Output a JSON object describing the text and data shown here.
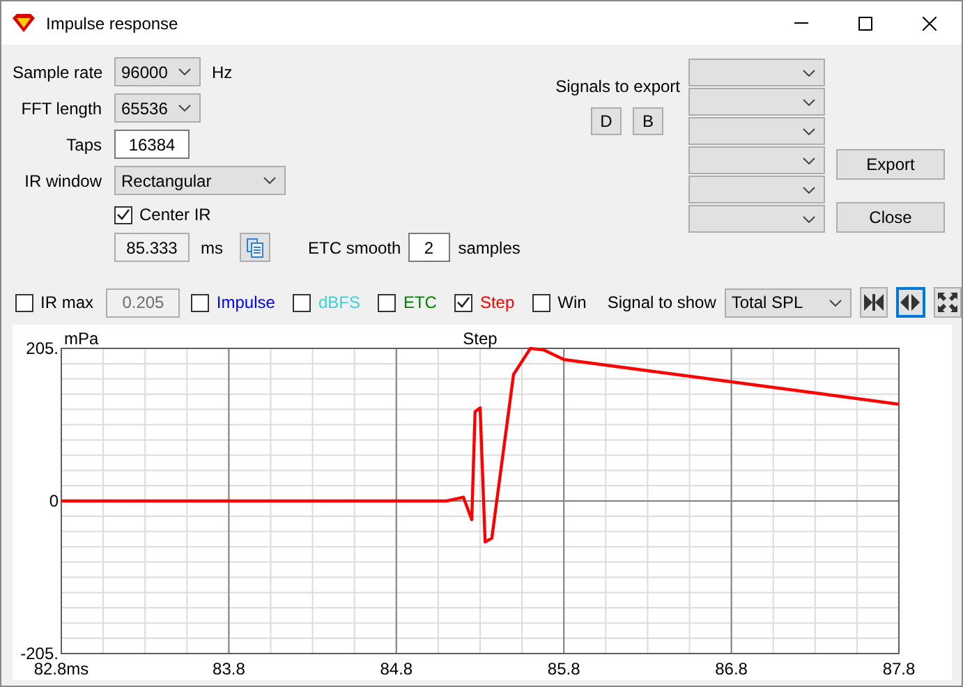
{
  "window": {
    "title": "Impulse response"
  },
  "form": {
    "fields": [
      {
        "kind": "select",
        "label": "Sample rate",
        "value": "96000",
        "unit": "Hz"
      },
      {
        "kind": "select",
        "label": "FFT length",
        "value": "65536"
      },
      {
        "kind": "input",
        "label": "Taps",
        "value": "16384"
      },
      {
        "kind": "select",
        "label": "IR window",
        "value": "Rectangular"
      }
    ],
    "center_ir": {
      "label": "Center IR",
      "checked": true
    },
    "delay": {
      "value": "85.333",
      "unit": "ms"
    },
    "etc_smooth": {
      "label": "ETC smooth",
      "value": "2",
      "unit": "samples"
    }
  },
  "export": {
    "label": "Signals to export",
    "buttons": [
      "D",
      "B"
    ],
    "slots": [
      {
        "kind": "dropdown"
      },
      {
        "kind": "dropdown"
      },
      {
        "kind": "dropdown"
      },
      {
        "kind": "dropdown"
      },
      {
        "kind": "dropdown"
      },
      {
        "kind": "dropdown"
      }
    ],
    "actions": [
      "Export",
      "Close"
    ]
  },
  "toolbar": {
    "ir_max": {
      "label": "IR max",
      "checked": false,
      "value": "0.205",
      "disabled": true
    },
    "traces": [
      {
        "label": "Impulse",
        "checked": false,
        "color": "#0000ff"
      },
      {
        "label": "dBFS",
        "checked": false,
        "color": "#40d0d0"
      },
      {
        "label": "ETC",
        "checked": false,
        "color": "#008000"
      },
      {
        "label": "Step",
        "checked": true,
        "color": "#ff0000"
      },
      {
        "label": "Win",
        "checked": false,
        "color": "#000000"
      }
    ],
    "signal": {
      "label": "Signal to show",
      "value": "Total SPL"
    },
    "view_buttons": [
      {
        "kind": "collapse",
        "selected": false
      },
      {
        "kind": "expand",
        "selected": true
      },
      {
        "kind": "fit",
        "selected": false
      }
    ]
  },
  "chart": {
    "chart_data": {
      "type": "line",
      "ylabel": "mPa",
      "grid": true,
      "x": [
        82.8,
        85.1,
        85.2,
        85.25,
        85.27,
        85.3,
        85.33,
        85.37,
        85.5,
        85.6,
        85.68,
        85.8,
        86.3,
        86.8,
        87.3,
        87.8
      ],
      "series": [
        {
          "name": "Step",
          "color": "#ff0000",
          "values": [
            0,
            0,
            5,
            -25,
            120,
            125,
            -55,
            -50,
            170,
            205,
            203,
            190,
            175,
            160,
            145,
            130
          ]
        }
      ],
      "xlim": [
        82.8,
        87.8
      ],
      "ylim": [
        -205,
        205
      ],
      "xticks": [
        {
          "value": 82.8,
          "label": "82.8ms"
        },
        {
          "value": 83.8,
          "label": "83.8"
        },
        {
          "value": 84.8,
          "label": "84.8"
        },
        {
          "value": 85.8,
          "label": "85.8"
        },
        {
          "value": 86.8,
          "label": "86.8"
        },
        {
          "value": 87.8,
          "label": "87.8"
        }
      ],
      "yticks": [
        {
          "value": -205,
          "label": "-205."
        },
        {
          "value": 0,
          "label": "0"
        },
        {
          "value": 205,
          "label": "205."
        }
      ]
    }
  }
}
